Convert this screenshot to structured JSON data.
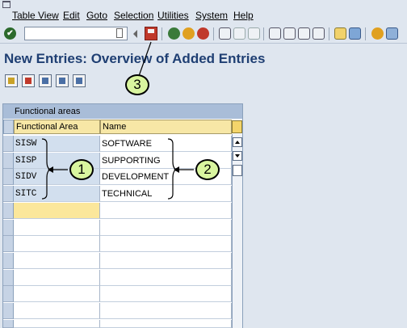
{
  "menu": {
    "items": [
      "Table View",
      "Edit",
      "Goto",
      "Selection",
      "Utilities",
      "System",
      "Help"
    ]
  },
  "toolbar": {
    "command_value": ""
  },
  "title": "New Entries: Overview of Added Entries",
  "table": {
    "title": "Functional areas",
    "columns": [
      "Functional Area",
      "Name"
    ],
    "rows": [
      {
        "area": "SISW",
        "name": "SOFTWARE"
      },
      {
        "area": "SISP",
        "name": "SUPPORTING"
      },
      {
        "area": "SIDV",
        "name": "DEVELOPMENT"
      },
      {
        "area": "SITC",
        "name": "TECHNICAL"
      }
    ]
  },
  "callouts": [
    "1",
    "2",
    "3"
  ],
  "colors": {
    "title": "#1f3f73",
    "table_header": "#f7e7a6",
    "callout_fill": "#d9f59f"
  }
}
